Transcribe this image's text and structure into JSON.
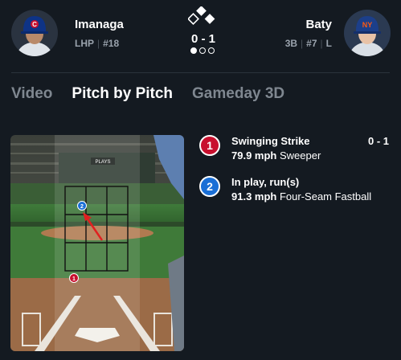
{
  "pitcher": {
    "name": "Imanaga",
    "position": "LHP",
    "number": "#18"
  },
  "batter": {
    "name": "Baty",
    "position": "3B",
    "number": "#7",
    "bats": "L"
  },
  "count": "0 - 1",
  "outs": [
    true,
    false,
    false
  ],
  "tabs": [
    {
      "label": "Video",
      "active": false
    },
    {
      "label": "Pitch by Pitch",
      "active": true
    },
    {
      "label": "Gameday 3D",
      "active": false
    }
  ],
  "video": {
    "scoreboard_text": "PLAYS"
  },
  "pitches": [
    {
      "number": "1",
      "result": "Swinging Strike",
      "speed": "79.9 mph",
      "type": "Sweeper",
      "count": "0 - 1",
      "color": "#c8102e"
    },
    {
      "number": "2",
      "result": "In play, run(s)",
      "speed": "91.3 mph",
      "type": "Four-Seam Fastball",
      "count": "",
      "color": "#1a6fd6"
    }
  ],
  "colors": {
    "background": "#141a21",
    "strike": "#c8102e",
    "in_play": "#1a6fd6",
    "cubs_blue": "#0e3386",
    "mets_orange": "#ff5910"
  }
}
